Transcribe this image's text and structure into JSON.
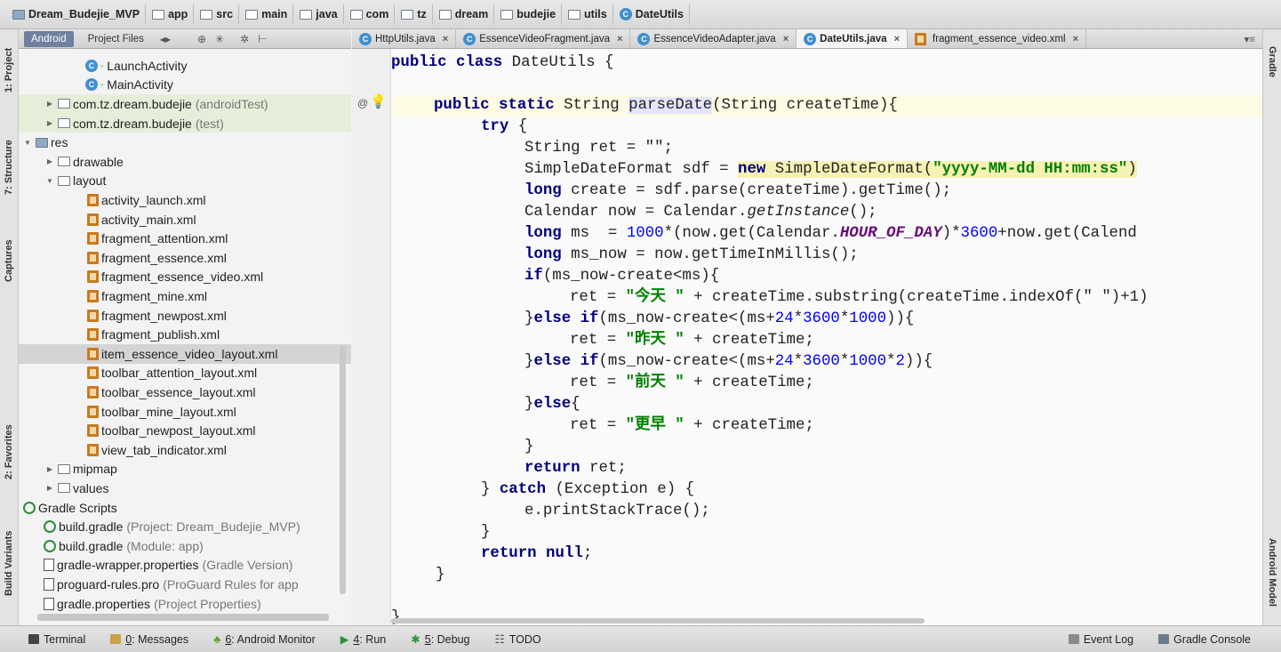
{
  "breadcrumb": [
    "Dream_Budejie_MVP",
    "app",
    "src",
    "main",
    "java",
    "com",
    "tz",
    "dream",
    "budejie",
    "utils",
    "DateUtils"
  ],
  "left_tabs": {
    "project": "1: Project",
    "structure": "7: Structure",
    "captures": "Captures",
    "favorites": "2: Favorites",
    "build_variants": "Build Variants"
  },
  "right_tabs": {
    "gradle": "Gradle",
    "android_model": "Android Model"
  },
  "project_panel": {
    "tab_android": "Android",
    "tab_project_files": "Project Files"
  },
  "tree": [
    {
      "label": "LaunchActivity",
      "kind": "class",
      "indent": 75
    },
    {
      "label": "MainActivity",
      "kind": "class",
      "indent": 75
    },
    {
      "label": "com.tz.dream.budejie",
      "suffix": "(androidTest)",
      "kind": "pkg",
      "indent": 30,
      "arrow": "▶",
      "green": true
    },
    {
      "label": "com.tz.dream.budejie",
      "suffix": "(test)",
      "kind": "pkg",
      "indent": 30,
      "arrow": "▶",
      "green": true
    },
    {
      "label": "res",
      "kind": "resfolder",
      "indent": 5,
      "arrow": "▼"
    },
    {
      "label": "drawable",
      "kind": "folder",
      "indent": 30,
      "arrow": "▶"
    },
    {
      "label": "layout",
      "kind": "folder",
      "indent": 30,
      "arrow": "▼"
    },
    {
      "label": "activity_launch.xml",
      "kind": "xml",
      "indent": 77
    },
    {
      "label": "activity_main.xml",
      "kind": "xml",
      "indent": 77
    },
    {
      "label": "fragment_attention.xml",
      "kind": "xml",
      "indent": 77
    },
    {
      "label": "fragment_essence.xml",
      "kind": "xml",
      "indent": 77
    },
    {
      "label": "fragment_essence_video.xml",
      "kind": "xml",
      "indent": 77
    },
    {
      "label": "fragment_mine.xml",
      "kind": "xml",
      "indent": 77
    },
    {
      "label": "fragment_newpost.xml",
      "kind": "xml",
      "indent": 77
    },
    {
      "label": "fragment_publish.xml",
      "kind": "xml",
      "indent": 77
    },
    {
      "label": "item_essence_video_layout.xml",
      "kind": "xml",
      "indent": 77,
      "selected": true
    },
    {
      "label": "toolbar_attention_layout.xml",
      "kind": "xml",
      "indent": 77
    },
    {
      "label": "toolbar_essence_layout.xml",
      "kind": "xml",
      "indent": 77
    },
    {
      "label": "toolbar_mine_layout.xml",
      "kind": "xml",
      "indent": 77
    },
    {
      "label": "toolbar_newpost_layout.xml",
      "kind": "xml",
      "indent": 77
    },
    {
      "label": "view_tab_indicator.xml",
      "kind": "xml",
      "indent": 77
    },
    {
      "label": "mipmap",
      "kind": "folder",
      "indent": 30,
      "arrow": "▶"
    },
    {
      "label": "values",
      "kind": "folder",
      "indent": 30,
      "arrow": "▶"
    },
    {
      "label": "Gradle Scripts",
      "kind": "gradle",
      "indent": 5
    },
    {
      "label": "build.gradle",
      "suffix": "(Project: Dream_Budejie_MVP)",
      "kind": "gradle",
      "indent": 28
    },
    {
      "label": "build.gradle",
      "suffix": "(Module: app)",
      "kind": "gradle",
      "indent": 28
    },
    {
      "label": "gradle-wrapper.properties",
      "suffix": "(Gradle Version)",
      "kind": "props",
      "indent": 28
    },
    {
      "label": "proguard-rules.pro",
      "suffix": "(ProGuard Rules for app",
      "kind": "props",
      "indent": 28
    },
    {
      "label": "gradle.properties",
      "suffix": "(Project Properties)",
      "kind": "props",
      "indent": 28
    }
  ],
  "editor_tabs": [
    {
      "label": "HttpUtils.java",
      "active": false,
      "kind": "class"
    },
    {
      "label": "EssenceVideoFragment.java",
      "active": false,
      "kind": "class"
    },
    {
      "label": "EssenceVideoAdapter.java",
      "active": false,
      "kind": "class"
    },
    {
      "label": "DateUtils.java",
      "active": true,
      "kind": "class"
    },
    {
      "label": "fragment_essence_video.xml",
      "active": false,
      "kind": "xml"
    }
  ],
  "code": {
    "l1_kw": "public class",
    "l1_rest": " DateUtils {",
    "l3_kw": "public static",
    "l3_mid": " String ",
    "l3_method": "parseDate",
    "l3_rest": "(String createTime){",
    "l4_kw": "try",
    "l4_rest": " {",
    "l5": "String ret = \"\";",
    "l6_a": "SimpleDateFormat sdf = ",
    "l6_kw": "new",
    "l6_b": " SimpleDateFormat(",
    "l6_str": "\"yyyy-MM-dd HH:mm:ss\"",
    "l6_c": ")",
    "l7_kw": "long",
    "l7_rest": " create = sdf.parse(createTime).getTime();",
    "l8_a": "Calendar now = Calendar.",
    "l8_it": "getInstance",
    "l8_b": "();",
    "l9_kw": "long",
    "l9_a": " ms  = ",
    "l9_num": "1000",
    "l9_b": "*(now.get(Calendar.",
    "l9_cst": "HOUR_OF_DAY",
    "l9_c": ")*",
    "l9_num2": "3600",
    "l9_d": "+now.get(Calend",
    "l10_kw": "long",
    "l10_rest": " ms_now = now.getTimeInMillis();",
    "l11_kw": "if",
    "l11_rest": "(ms_now-create<ms){",
    "l12_a": "ret = ",
    "l12_str": "\"今天 \"",
    "l12_b": " + createTime.substring(createTime.indexOf(\" \")+1)",
    "l13_a": "}",
    "l13_kw": "else if",
    "l13_b": "(ms_now-create<(ms+",
    "l13_n1": "24",
    "l13_c": "*",
    "l13_n2": "3600",
    "l13_d": "*",
    "l13_n3": "1000",
    "l13_e": ")){",
    "l14_a": "ret = ",
    "l14_str": "\"昨天 \"",
    "l14_b": " + createTime;",
    "l15_a": "}",
    "l15_kw": "else if",
    "l15_b": "(ms_now-create<(ms+",
    "l15_n1": "24",
    "l15_c": "*",
    "l15_n2": "3600",
    "l15_d": "*",
    "l15_n3": "1000",
    "l15_e": "*",
    "l15_n4": "2",
    "l15_f": ")){",
    "l16_a": "ret = ",
    "l16_str": "\"前天 \"",
    "l16_b": " + createTime;",
    "l17_a": "}",
    "l17_kw": "else",
    "l17_b": "{",
    "l18_a": "ret = ",
    "l18_str": "\"更早 \"",
    "l18_b": " + createTime;",
    "l19": "}",
    "l20_kw": "return",
    "l20_rest": " ret;",
    "l21_a": "} ",
    "l21_kw": "catch",
    "l21_b": " (Exception e) {",
    "l22": "e.printStackTrace();",
    "l23": "}",
    "l24_kw": "return null",
    "l24_rest": ";",
    "l25": "}",
    "l26": "}"
  },
  "bottom_bar": {
    "terminal": "Terminal",
    "messages_key": "0",
    "messages": ": Messages",
    "monitor_key": "6",
    "monitor": ": Android Monitor",
    "run_key": "4",
    "run": ": Run",
    "debug_key": "5",
    "debug": ": Debug",
    "todo": "TODO",
    "event_log": "Event Log",
    "gradle_console": "Gradle Console"
  },
  "colors": {
    "keyword": "#000080",
    "string": "#008000",
    "number": "#0000ff",
    "selection": "#d4d4d4",
    "active_tab": "#6f7fa0"
  }
}
